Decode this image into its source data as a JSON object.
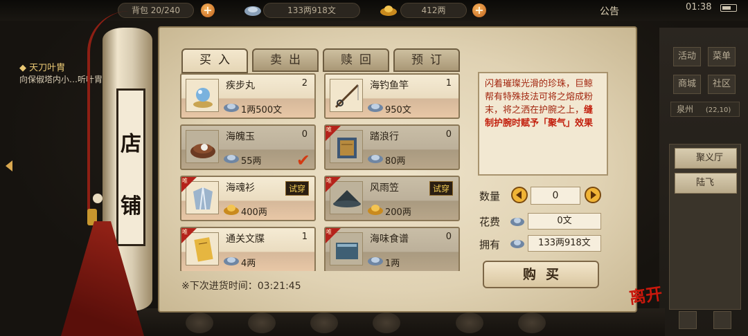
{
  "topbar": {
    "capacity": "背包 20/240",
    "copper": "133两918文",
    "gold": "412两",
    "notice": "公告",
    "time": "01:38"
  },
  "quest": {
    "title": "天刀叶胄",
    "text": "向保俶塔内小…听叶胄"
  },
  "scroll": {
    "char1": "店",
    "char2": "铺"
  },
  "tabs": [
    "买入",
    "卖出",
    "赎回",
    "预订"
  ],
  "items": [
    {
      "name": "疾步丸",
      "qty": "2",
      "price": "1两500文",
      "currency": "copper-icon",
      "icon": "pearl-pill-icon",
      "dim": false
    },
    {
      "name": "海钓鱼竿",
      "qty": "1",
      "price": "950文",
      "currency": "copper-icon",
      "icon": "fishing-rod-icon",
      "dim": false
    },
    {
      "name": "海魄玉",
      "qty": "0",
      "price": "55两",
      "currency": "copper-icon",
      "icon": "jade-pearl-icon",
      "dim": true,
      "selected": true
    },
    {
      "name": "踏浪行",
      "qty": "0",
      "price": "80两",
      "currency": "copper-icon",
      "icon": "book-icon",
      "dim": true,
      "unique": true
    },
    {
      "name": "海魂衫",
      "tag": "试穿",
      "price": "400两",
      "currency": "gold-icon",
      "icon": "robe-icon",
      "dim": false,
      "unique": true
    },
    {
      "name": "风雨笠",
      "tag": "试穿",
      "price": "200两",
      "currency": "gold-icon",
      "icon": "straw-hat-icon",
      "dim": true,
      "unique": true
    },
    {
      "name": "通关文牒",
      "qty": "1",
      "price": "4两",
      "currency": "copper-icon",
      "icon": "document-icon",
      "dim": false,
      "unique": true
    },
    {
      "name": "海味食谱",
      "qty": "0",
      "price": "1两",
      "currency": "copper-icon",
      "icon": "recipe-book-icon",
      "dim": true,
      "unique": true
    }
  ],
  "restock": "※下次进货时间：03:21:45",
  "description": {
    "normal": "闪着璀璨光滑的珍珠，巨鲸帮有特殊技法可将之熔成粉末，将之洒在护腕之上，",
    "highlight": "缝制护腕时赋予「聚气」效果"
  },
  "purchase": {
    "qty_label": "数量",
    "qty_value": "0",
    "cost_label": "花费",
    "cost_value": "0文",
    "own_label": "拥有",
    "own_value": "133两918文",
    "buy_label": "购买"
  },
  "right_panel": {
    "buttons": [
      "活动",
      "菜单",
      "商城",
      "社区"
    ],
    "city": "泉州",
    "coord": "(22,10)",
    "players": [
      "聚义厅",
      "陆飞"
    ]
  },
  "leave_label": "离开",
  "colors": {
    "paper": "#e6d9bc",
    "accent_red": "#b5231b",
    "gold": "#f2cc55"
  }
}
